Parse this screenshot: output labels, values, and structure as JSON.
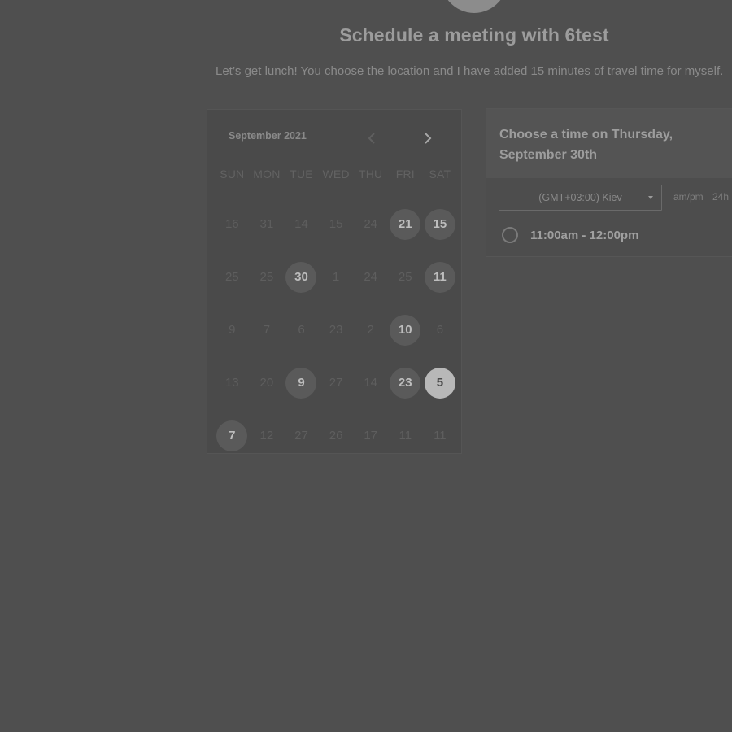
{
  "page": {
    "title": "Schedule a meeting with 6test",
    "subtitle": "Let’s get lunch! You choose the location and I have added 15 minutes of travel time for myself."
  },
  "calendar": {
    "month_label": "September 2021",
    "prev_icon": "chevron-left-icon",
    "next_icon": "chevron-right-icon",
    "weekdays": [
      "SUN",
      "MON",
      "TUE",
      "WED",
      "THU",
      "FRI",
      "SAT"
    ],
    "weeks": [
      [
        {
          "d": "16",
          "s": "disabled"
        },
        {
          "d": "31",
          "s": "disabled"
        },
        {
          "d": "14",
          "s": "disabled"
        },
        {
          "d": "15",
          "s": "disabled"
        },
        {
          "d": "24",
          "s": "disabled"
        },
        {
          "d": "21",
          "s": "available"
        },
        {
          "d": "15",
          "s": "available"
        }
      ],
      [
        {
          "d": "25",
          "s": "disabled"
        },
        {
          "d": "25",
          "s": "disabled"
        },
        {
          "d": "30",
          "s": "available"
        },
        {
          "d": "1",
          "s": "disabled"
        },
        {
          "d": "24",
          "s": "disabled"
        },
        {
          "d": "25",
          "s": "disabled"
        },
        {
          "d": "11",
          "s": "available"
        }
      ],
      [
        {
          "d": "9",
          "s": "disabled"
        },
        {
          "d": "7",
          "s": "disabled"
        },
        {
          "d": "6",
          "s": "disabled"
        },
        {
          "d": "23",
          "s": "disabled"
        },
        {
          "d": "2",
          "s": "disabled"
        },
        {
          "d": "10",
          "s": "available"
        },
        {
          "d": "6",
          "s": "disabled"
        }
      ],
      [
        {
          "d": "13",
          "s": "disabled"
        },
        {
          "d": "20",
          "s": "disabled"
        },
        {
          "d": "9",
          "s": "available"
        },
        {
          "d": "27",
          "s": "disabled"
        },
        {
          "d": "14",
          "s": "disabled"
        },
        {
          "d": "23",
          "s": "available"
        },
        {
          "d": "5",
          "s": "selected"
        }
      ],
      [
        {
          "d": "7",
          "s": "available"
        },
        {
          "d": "12",
          "s": "disabled"
        },
        {
          "d": "27",
          "s": "disabled"
        },
        {
          "d": "26",
          "s": "disabled"
        },
        {
          "d": "17",
          "s": "disabled"
        },
        {
          "d": "11",
          "s": "disabled"
        },
        {
          "d": "11",
          "s": "disabled"
        }
      ]
    ]
  },
  "times": {
    "heading": "Choose a time on Thursday, September 30th",
    "timezone": "(GMT+03:00) Kiev",
    "format_ampm": "am/pm",
    "format_24h": "24h",
    "slots": [
      {
        "label": "11:00am - 12:00pm"
      }
    ]
  },
  "colors": {
    "background": "#4f4f4f",
    "available_day_bg": "#5a5a5a",
    "selected_day_bg": "#b8b8b8"
  }
}
